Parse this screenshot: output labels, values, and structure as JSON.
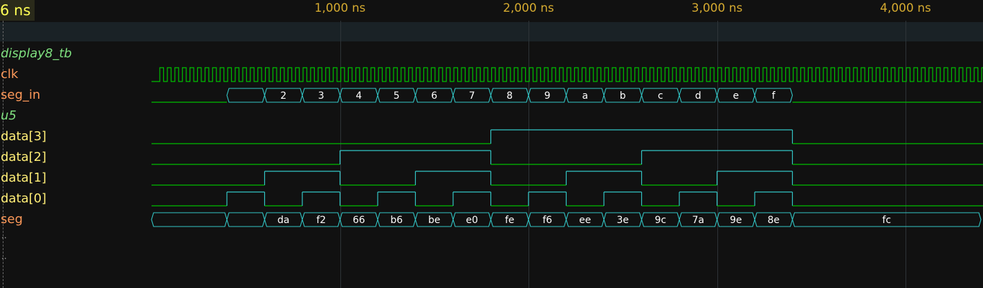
{
  "cursor_time": "6 ns",
  "time_ticks": [
    {
      "t": 1000,
      "label": "1,000 ns"
    },
    {
      "t": 2000,
      "label": "2,000 ns"
    },
    {
      "t": 3000,
      "label": "3,000 ns"
    },
    {
      "t": 4000,
      "label": "4,000 ns"
    }
  ],
  "colors": {
    "low_wave": "#00c000",
    "high_wave": "#33c8c8",
    "bus_outline": "#33c8c8",
    "scope_text": "#7fe07f",
    "signal_text_orange": "#ff9a5a",
    "signal_text_yellow": "#ffee77",
    "tick_text": "#d4aa30",
    "cursor_text": "#ffff55"
  },
  "clock": {
    "period_ns": 40
  },
  "signals": [
    {
      "name": "display8_tb",
      "kind": "scope",
      "style": "scope"
    },
    {
      "name": "clk",
      "kind": "clock",
      "style": "orange"
    },
    {
      "name": "seg_in",
      "kind": "bus",
      "style": "orange",
      "segments": [
        {
          "start": -10,
          "end": 400,
          "value": ""
        },
        {
          "start": 400,
          "end": 600,
          "value": ""
        },
        {
          "start": 600,
          "end": 800,
          "value": "2"
        },
        {
          "start": 800,
          "end": 1000,
          "value": "3"
        },
        {
          "start": 1000,
          "end": 1200,
          "value": "4"
        },
        {
          "start": 1200,
          "end": 1400,
          "value": "5"
        },
        {
          "start": 1400,
          "end": 1600,
          "value": "6"
        },
        {
          "start": 1600,
          "end": 1800,
          "value": "7"
        },
        {
          "start": 1800,
          "end": 2000,
          "value": "8"
        },
        {
          "start": 2000,
          "end": 2200,
          "value": "9"
        },
        {
          "start": 2200,
          "end": 2400,
          "value": "a"
        },
        {
          "start": 2400,
          "end": 2600,
          "value": "b"
        },
        {
          "start": 2600,
          "end": 2800,
          "value": "c"
        },
        {
          "start": 2800,
          "end": 3000,
          "value": "d"
        },
        {
          "start": 3000,
          "end": 3200,
          "value": "e"
        },
        {
          "start": 3200,
          "end": 3400,
          "value": "f"
        },
        {
          "start": 3400,
          "end": 4400,
          "value": ""
        }
      ],
      "low_segments": [
        0,
        16
      ]
    },
    {
      "name": "u5",
      "kind": "scope",
      "style": "scope"
    },
    {
      "name": "data[3]",
      "kind": "bit",
      "style": "yellow",
      "transitions": [
        {
          "t": -10,
          "v": 0
        },
        {
          "t": 1800,
          "v": 1
        },
        {
          "t": 3400,
          "v": 0
        }
      ]
    },
    {
      "name": "data[2]",
      "kind": "bit",
      "style": "yellow",
      "transitions": [
        {
          "t": -10,
          "v": 0
        },
        {
          "t": 1000,
          "v": 1
        },
        {
          "t": 1800,
          "v": 0
        },
        {
          "t": 2600,
          "v": 1
        },
        {
          "t": 3400,
          "v": 0
        }
      ]
    },
    {
      "name": "data[1]",
      "kind": "bit",
      "style": "yellow",
      "transitions": [
        {
          "t": -10,
          "v": 0
        },
        {
          "t": 600,
          "v": 1
        },
        {
          "t": 1000,
          "v": 0
        },
        {
          "t": 1400,
          "v": 1
        },
        {
          "t": 1800,
          "v": 0
        },
        {
          "t": 2200,
          "v": 1
        },
        {
          "t": 2600,
          "v": 0
        },
        {
          "t": 3000,
          "v": 1
        },
        {
          "t": 3400,
          "v": 0
        }
      ]
    },
    {
      "name": "data[0]",
      "kind": "bit",
      "style": "yellow",
      "transitions": [
        {
          "t": -10,
          "v": 0
        },
        {
          "t": 400,
          "v": 1
        },
        {
          "t": 600,
          "v": 0
        },
        {
          "t": 800,
          "v": 1
        },
        {
          "t": 1000,
          "v": 0
        },
        {
          "t": 1200,
          "v": 1
        },
        {
          "t": 1400,
          "v": 0
        },
        {
          "t": 1600,
          "v": 1
        },
        {
          "t": 1800,
          "v": 0
        },
        {
          "t": 2000,
          "v": 1
        },
        {
          "t": 2200,
          "v": 0
        },
        {
          "t": 2400,
          "v": 1
        },
        {
          "t": 2600,
          "v": 0
        },
        {
          "t": 2800,
          "v": 1
        },
        {
          "t": 3000,
          "v": 0
        },
        {
          "t": 3200,
          "v": 1
        },
        {
          "t": 3400,
          "v": 0
        }
      ]
    },
    {
      "name": "seg",
      "kind": "bus",
      "style": "orange",
      "segments": [
        {
          "start": -10,
          "end": 400,
          "value": ""
        },
        {
          "start": 400,
          "end": 600,
          "value": ""
        },
        {
          "start": 600,
          "end": 800,
          "value": "da"
        },
        {
          "start": 800,
          "end": 1000,
          "value": "f2"
        },
        {
          "start": 1000,
          "end": 1200,
          "value": "66"
        },
        {
          "start": 1200,
          "end": 1400,
          "value": "b6"
        },
        {
          "start": 1400,
          "end": 1600,
          "value": "be"
        },
        {
          "start": 1600,
          "end": 1800,
          "value": "e0"
        },
        {
          "start": 1800,
          "end": 2000,
          "value": "fe"
        },
        {
          "start": 2000,
          "end": 2200,
          "value": "f6"
        },
        {
          "start": 2200,
          "end": 2400,
          "value": "ee"
        },
        {
          "start": 2400,
          "end": 2600,
          "value": "3e"
        },
        {
          "start": 2600,
          "end": 2800,
          "value": "9c"
        },
        {
          "start": 2800,
          "end": 3000,
          "value": "7a"
        },
        {
          "start": 3000,
          "end": 3200,
          "value": "9e"
        },
        {
          "start": 3200,
          "end": 3400,
          "value": "8e"
        },
        {
          "start": 3400,
          "end": 4400,
          "value": "fc"
        }
      ],
      "low_segments": []
    }
  ],
  "ellipsis_rows": [
    "..",
    ".."
  ]
}
